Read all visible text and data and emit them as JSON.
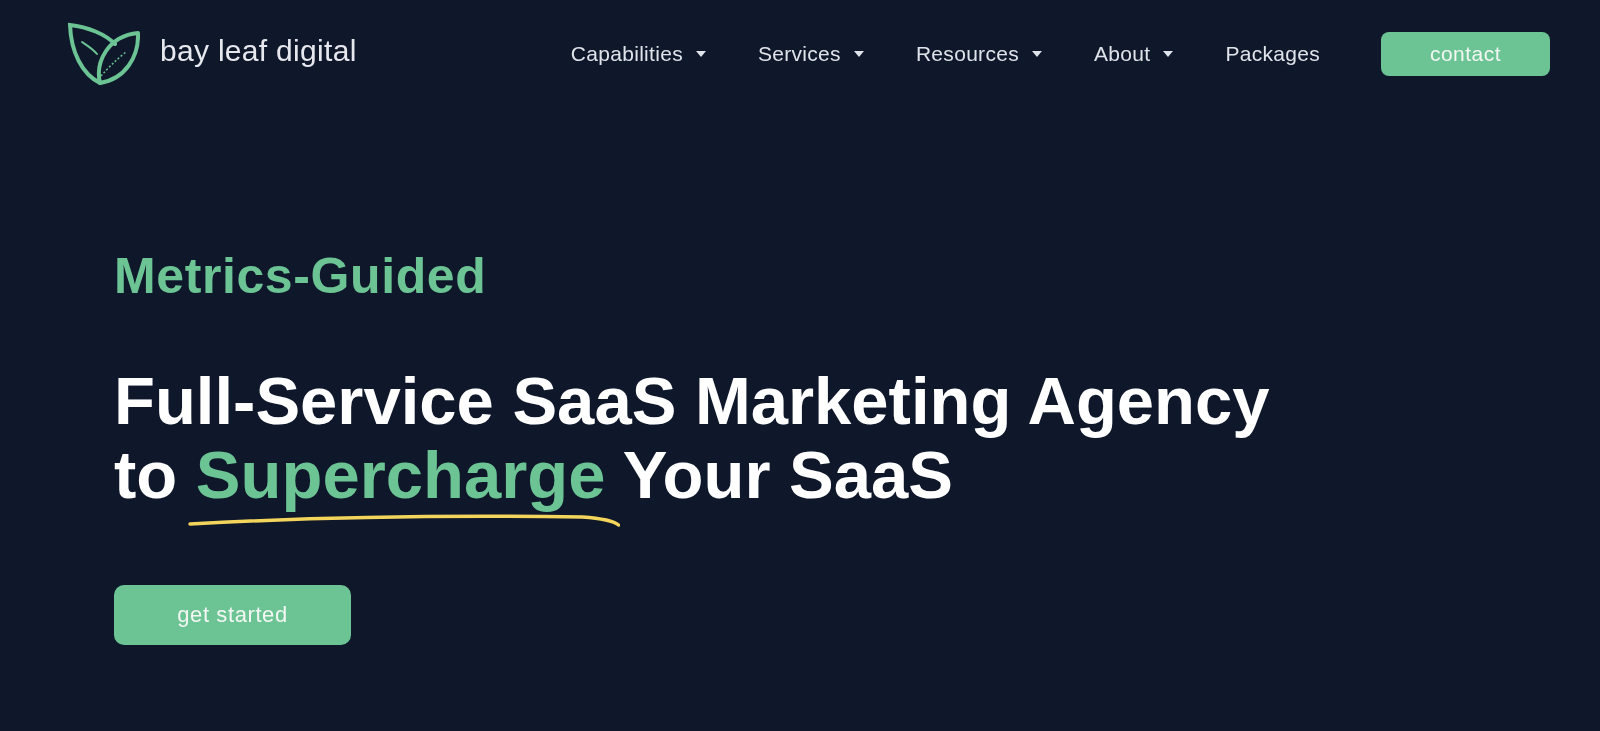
{
  "header": {
    "brand": "bay leaf digital",
    "nav": [
      {
        "label": "Capabilities",
        "has_dropdown": true
      },
      {
        "label": "Services",
        "has_dropdown": true
      },
      {
        "label": "Resources",
        "has_dropdown": true
      },
      {
        "label": "About",
        "has_dropdown": true
      },
      {
        "label": "Packages",
        "has_dropdown": false
      }
    ],
    "contact_button": "contact"
  },
  "hero": {
    "eyebrow": "Metrics-Guided",
    "headline": {
      "line_1": "Full-Service SaaS Marketing Agency",
      "line_2_start": "to",
      "highlight": "Supercharge",
      "line_2_end": "Your SaaS",
      "underlined": true
    },
    "cta_button": "get started"
  }
}
